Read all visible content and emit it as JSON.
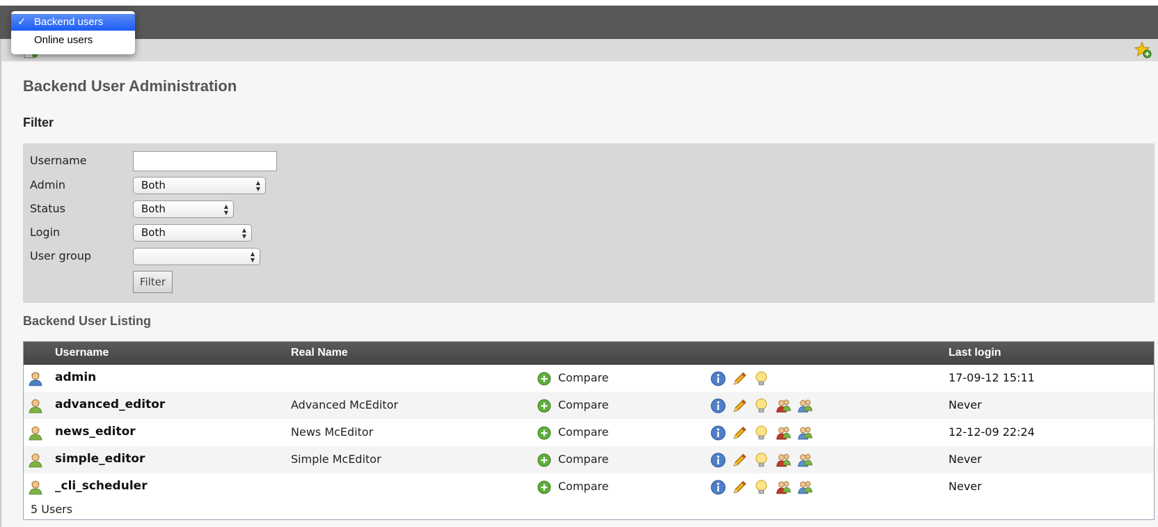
{
  "menu": {
    "options": [
      {
        "check": "✓",
        "label": "Backend users"
      },
      {
        "check": "",
        "label": "Online users"
      }
    ]
  },
  "page": {
    "title": "Backend User Administration"
  },
  "filter": {
    "title": "Filter",
    "username_label": "Username",
    "username_value": "",
    "admin_label": "Admin",
    "admin_value": "Both",
    "status_label": "Status",
    "status_value": "Both",
    "login_label": "Login",
    "login_value": "Both",
    "usergroup_label": "User group",
    "usergroup_value": "",
    "button_label": "Filter"
  },
  "listing": {
    "title": "Backend User Listing",
    "headers": {
      "username": "Username",
      "realname": "Real Name",
      "lastlogin": "Last login"
    },
    "compare_label": "Compare",
    "rows": [
      {
        "username": "admin",
        "realname": "",
        "lastlogin": "17-09-12 15:11",
        "admin": true
      },
      {
        "username": "advanced_editor",
        "realname": "Advanced McEditor",
        "lastlogin": "Never",
        "admin": false
      },
      {
        "username": "news_editor",
        "realname": "News McEditor",
        "lastlogin": "12-12-09 22:24",
        "admin": false
      },
      {
        "username": "simple_editor",
        "realname": "Simple McEditor",
        "lastlogin": "Never",
        "admin": false
      },
      {
        "username": "_cli_scheduler",
        "realname": "",
        "lastlogin": "Never",
        "admin": false
      }
    ],
    "count_text": "5 Users"
  },
  "colors": {
    "docheader": "#585858",
    "table_header": "#4e4e4e",
    "filter_box": "#d8d8d8",
    "menu_selected": "#2a66f3",
    "admin_user_icon": "#4a7fc1",
    "editor_user_icon": "#7cb342"
  },
  "icons": {
    "info": "info-icon",
    "edit": "edit-pencil-icon",
    "bulb": "lightbulb-icon",
    "switch": "switch-user-icon",
    "switchback": "switch-back-user-icon",
    "compare": "compare-add-icon",
    "shortcut": "add-shortcut-star-icon"
  }
}
